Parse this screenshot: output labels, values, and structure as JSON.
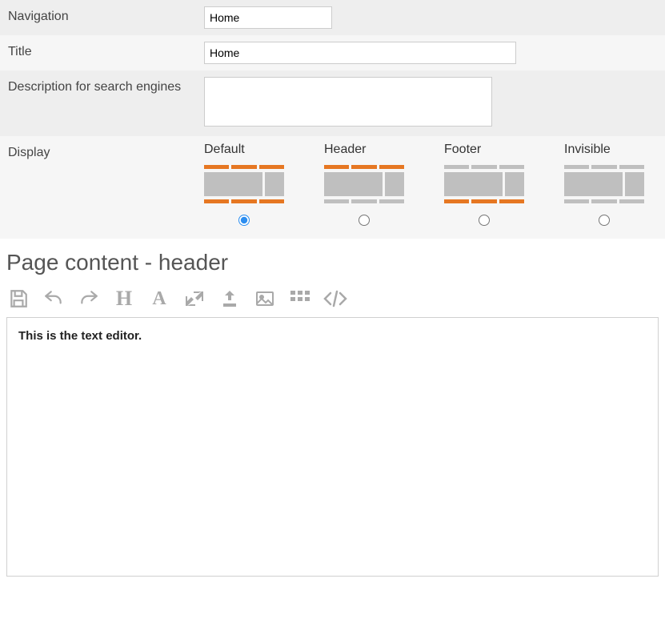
{
  "form": {
    "navigation": {
      "label": "Navigation",
      "value": "Home"
    },
    "title": {
      "label": "Title",
      "value": "Home"
    },
    "description": {
      "label": "Description for search engines",
      "value": ""
    },
    "display": {
      "label": "Display",
      "selected": "default",
      "options": [
        {
          "key": "default",
          "label": "Default",
          "top": "orange",
          "bottom": "orange"
        },
        {
          "key": "header",
          "label": "Header",
          "top": "orange",
          "bottom": "gray"
        },
        {
          "key": "footer",
          "label": "Footer",
          "top": "gray",
          "bottom": "orange"
        },
        {
          "key": "invisible",
          "label": "Invisible",
          "top": "gray",
          "bottom": "gray"
        }
      ]
    }
  },
  "section_heading": "Page content - header",
  "editor": {
    "content": "This is the text editor."
  }
}
